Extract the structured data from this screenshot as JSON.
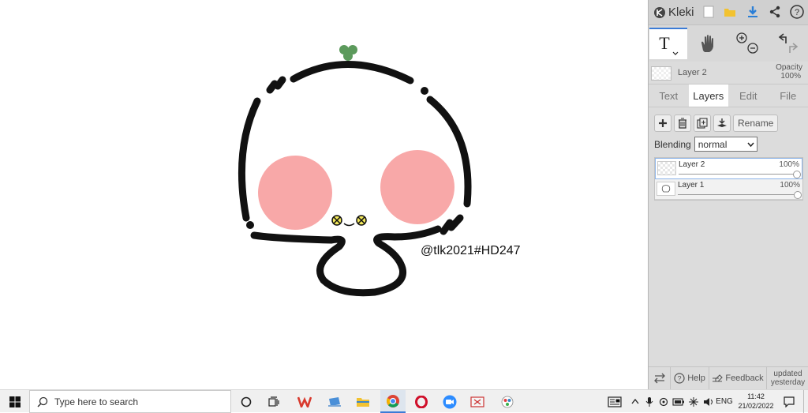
{
  "canvas": {
    "watermark": "@tlk2021#HD247"
  },
  "app": {
    "name": "Kleki",
    "active_layer_name": "Layer 2",
    "opacity_label": "Opacity",
    "opacity_value": "100%"
  },
  "tabs": [
    {
      "label": "Text",
      "active": false
    },
    {
      "label": "Layers",
      "active": true
    },
    {
      "label": "Edit",
      "active": false
    },
    {
      "label": "File",
      "active": false
    }
  ],
  "layer_actions": {
    "rename_label": "Rename"
  },
  "blending": {
    "label": "Blending",
    "value": "normal"
  },
  "layers": [
    {
      "name": "Layer 2",
      "opacity": "100%",
      "opacity_fraction": 1.0,
      "active": true
    },
    {
      "name": "Layer 1",
      "opacity": "100%",
      "opacity_fraction": 1.0,
      "active": false
    }
  ],
  "footer": {
    "help_label": "Help",
    "feedback_label": "Feedback",
    "updated_line1": "updated",
    "updated_line2": "yesterday"
  },
  "taskbar": {
    "search_placeholder": "Type here to search",
    "language": "ENG",
    "time": "11:42",
    "date": "21/02/2022"
  },
  "colors": {
    "blush": "#f8a8a8",
    "leaf": "#5c9a5c",
    "outline": "#111111",
    "accent": "#3b7bd6"
  }
}
